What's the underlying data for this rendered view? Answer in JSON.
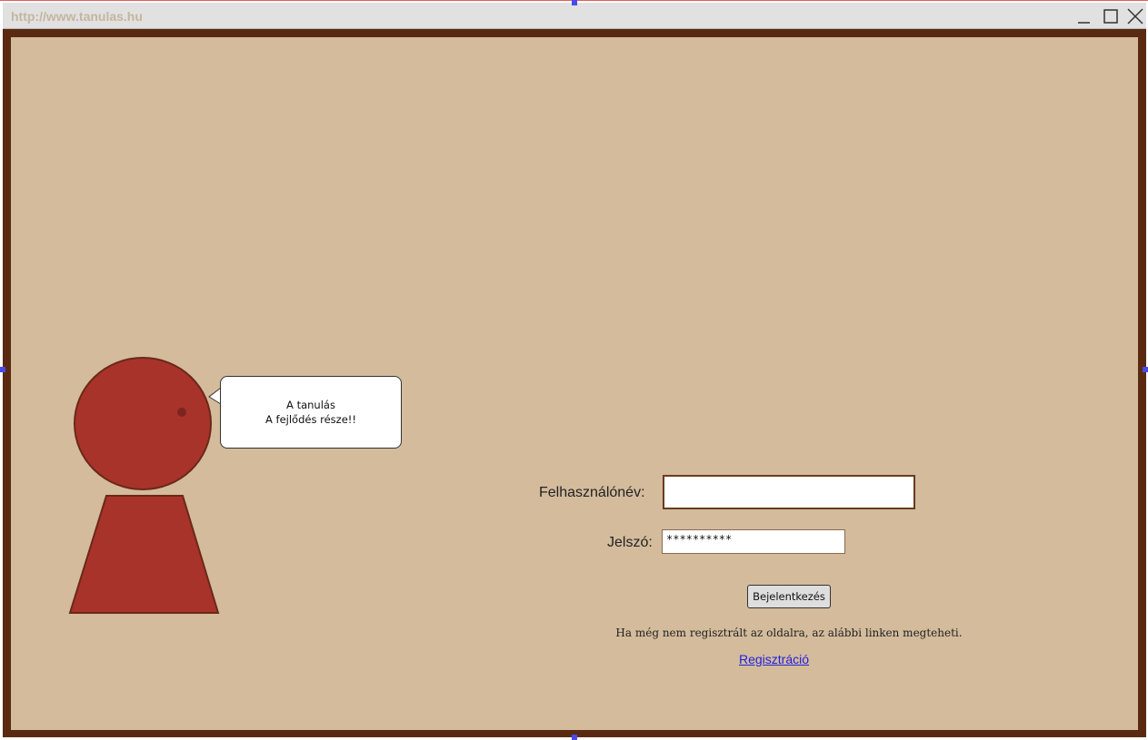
{
  "window": {
    "url": "http://www.tanulas.hu"
  },
  "speech_bubble": {
    "line1": "A tanulás",
    "line2": "A fejlődés része!!"
  },
  "login": {
    "username_label": "Felhasználónév:",
    "username_value": "",
    "password_label": "Jelszó:",
    "password_value": "**********",
    "login_button": "Bejelentkezés",
    "info_text": "Ha még nem regisztrált az oldalra, az alábbi linken megteheti.",
    "register_link": "Regisztráció"
  },
  "colors": {
    "frame": "#5a2a10",
    "background": "#d3bb9c",
    "figure": "#a8332b"
  }
}
